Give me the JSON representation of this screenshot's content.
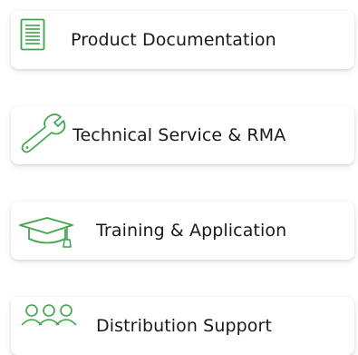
{
  "accent_color": "#3da64a",
  "links": [
    {
      "label": "Product Documentation",
      "icon": "document-icon"
    },
    {
      "label": "Technical Service & RMA",
      "icon": "wrench-icon"
    },
    {
      "label": "Training & Application",
      "icon": "graduation-cap-icon"
    },
    {
      "label": "Distribution Support",
      "icon": "people-group-icon"
    }
  ]
}
